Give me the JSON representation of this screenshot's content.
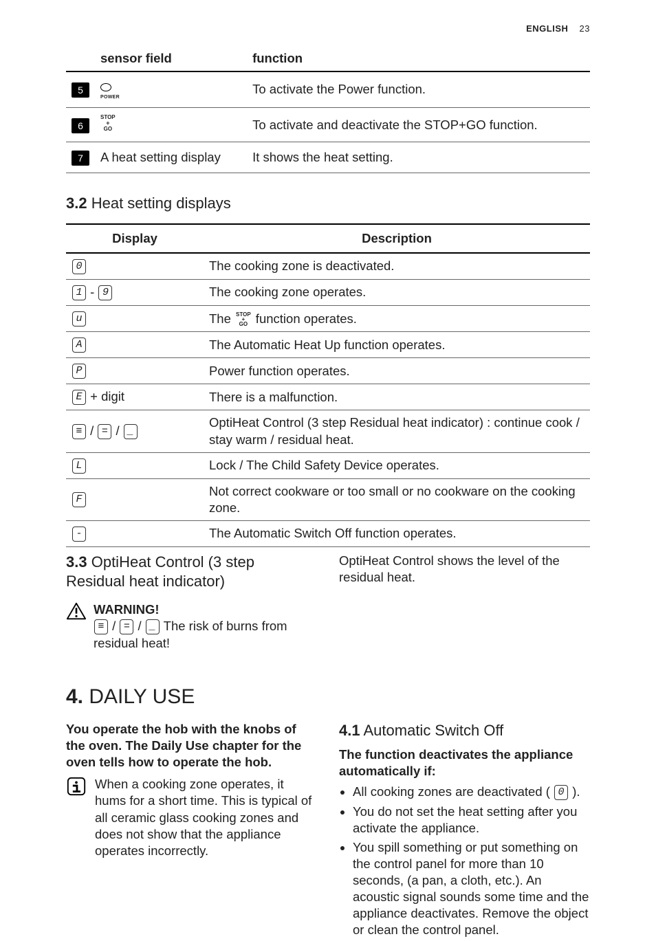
{
  "meta": {
    "lang": "ENGLISH",
    "page": "23"
  },
  "table1": {
    "headers": {
      "sensor": "sensor field",
      "function": "function"
    },
    "rows": [
      {
        "num": "5",
        "icon": "power",
        "fn": "To activate the Power function."
      },
      {
        "num": "6",
        "icon": "stopgo",
        "fn": "To activate and deactivate the STOP+GO function."
      },
      {
        "num": "7",
        "sensor_text": "A heat setting display",
        "fn": "It shows the heat setting."
      }
    ]
  },
  "sec32": {
    "num": "3.2",
    "title": "Heat setting displays"
  },
  "table2": {
    "headers": {
      "display": "Display",
      "description": "Description"
    },
    "rows": [
      {
        "disp": [
          {
            "seg": "0"
          }
        ],
        "desc": "The cooking zone is deactivated."
      },
      {
        "disp": [
          {
            "seg": "1"
          },
          {
            "text": " - "
          },
          {
            "seg": "9"
          }
        ],
        "desc": "The cooking zone operates."
      },
      {
        "disp": [
          {
            "seg": "u"
          }
        ],
        "desc_pre": "The ",
        "desc_stopgo": true,
        "desc_post": " function operates."
      },
      {
        "disp": [
          {
            "seg": "A"
          }
        ],
        "desc": "The Automatic Heat Up function operates."
      },
      {
        "disp": [
          {
            "seg": "P"
          }
        ],
        "desc": "Power function operates."
      },
      {
        "disp": [
          {
            "seg": "E"
          },
          {
            "text": " + digit"
          }
        ],
        "desc": "There is a malfunction."
      },
      {
        "disp": [
          {
            "seg": "≡"
          },
          {
            "text": " / "
          },
          {
            "seg": "="
          },
          {
            "text": " / "
          },
          {
            "seg": "_"
          }
        ],
        "desc": "OptiHeat Control (3 step Residual heat indicator) : continue cook / stay warm / residual heat."
      },
      {
        "disp": [
          {
            "seg": "L"
          }
        ],
        "desc": "Lock / The Child Safety Device operates."
      },
      {
        "disp": [
          {
            "seg": "F"
          }
        ],
        "desc": "Not correct cookware or too small or no cookware on the cooking zone."
      },
      {
        "disp": [
          {
            "seg": "-"
          }
        ],
        "desc": "The Automatic Switch Off function operates."
      }
    ]
  },
  "sec33": {
    "num": "3.3",
    "title": "OptiHeat Control (3 step Residual heat indicator)",
    "warning_label": "WARNING!",
    "warning_text": " The risk of burns from residual heat!",
    "right_text": "OptiHeat Control shows the level of the residual heat."
  },
  "sec4": {
    "num": "4.",
    "title": "DAILY USE",
    "intro": "You operate the hob with the knobs of the oven. The Daily Use chapter for the oven tells how to operate the hob.",
    "info": "When a cooking zone operates, it hums for a short time. This is typical of all ceramic glass cooking zones and does not show that the appliance operates incorrectly.",
    "sec41": {
      "num": "4.1",
      "title": "Automatic Switch Off"
    },
    "func_head": "The function deactivates the appliance automatically if:",
    "bullets": [
      {
        "pre": "All cooking zones are deactivated ( ",
        "seg": "0",
        "post": " )."
      },
      {
        "text": "You do not set the heat setting after you activate the appliance."
      },
      {
        "text": "You spill something or put something on the control panel for more than 10 seconds, (a pan, a cloth, etc.). An acoustic signal sounds some time and the appliance deactivates. Remove the object or clean the control panel."
      }
    ]
  }
}
